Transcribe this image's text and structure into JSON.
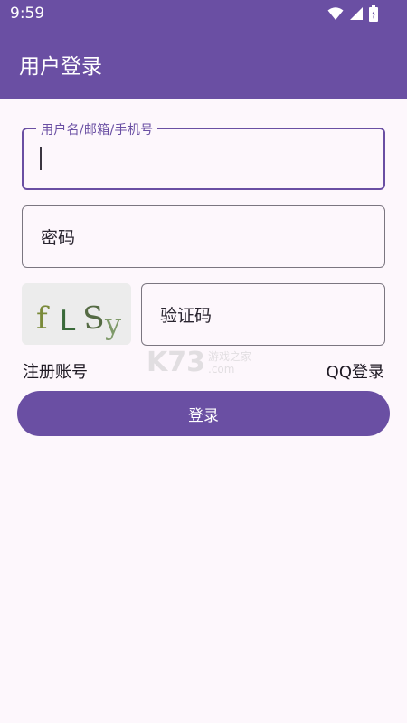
{
  "status": {
    "time": "9:59"
  },
  "app": {
    "title": "用户登录",
    "accent": "#6a4fa3"
  },
  "form": {
    "username_label": "用户名/邮箱/手机号",
    "password_placeholder": "密码",
    "captcha_placeholder": "验证码",
    "captcha_image_text": "fLSy"
  },
  "links": {
    "register": "注册账号",
    "qq_login": "QQ登录"
  },
  "login_button": "登录",
  "icons": [
    "wifi-icon",
    "signal-icon",
    "battery-icon"
  ]
}
